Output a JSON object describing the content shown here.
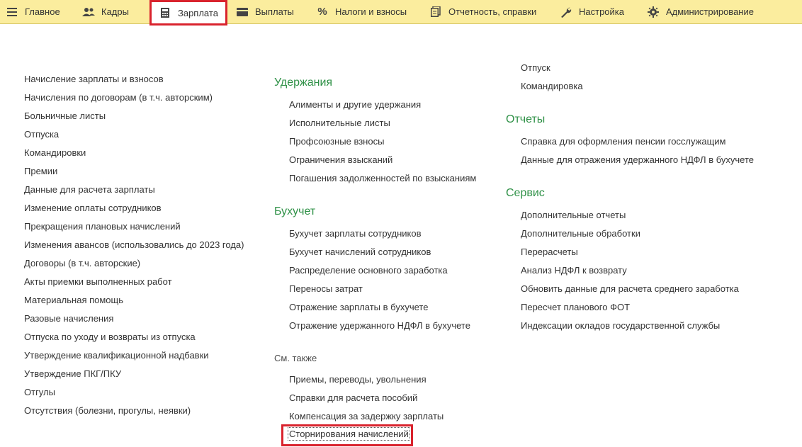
{
  "nav": {
    "tabs": [
      {
        "label": "Главное",
        "icon": "hamburger-menu-icon"
      },
      {
        "label": "Кадры",
        "icon": "people-icon"
      },
      {
        "label": "Зарплата",
        "icon": "calculator-icon",
        "active": true
      },
      {
        "label": "Выплаты",
        "icon": "wallet-icon"
      },
      {
        "label": "Налоги и взносы",
        "icon": "percent-icon"
      },
      {
        "label": "Отчетность, справки",
        "icon": "documents-icon"
      },
      {
        "label": "Настройка",
        "icon": "wrench-icon"
      },
      {
        "label": "Администрирование",
        "icon": "gear-icon"
      }
    ]
  },
  "col1": {
    "items": [
      "Начисление зарплаты и взносов",
      "Начисления по договорам (в т.ч. авторским)",
      "Больничные листы",
      "Отпуска",
      "Командировки",
      "Премии",
      "Данные для расчета зарплаты",
      "Изменение оплаты сотрудников",
      "Прекращения плановых начислений",
      "Изменения авансов (использовались до 2023 года)",
      "Договоры (в т.ч. авторские)",
      "Акты приемки выполненных работ",
      "Материальная помощь",
      "Разовые начисления",
      "Отпуска по уходу и возвраты из отпуска",
      "Утверждение квалификационной надбавки",
      "Утверждение ПКГ/ПКУ",
      "Отгулы",
      "Отсутствия (болезни, прогулы, неявки)"
    ]
  },
  "col2": {
    "uderzhaniya": {
      "title": "Удержания",
      "items": [
        "Алименты и другие удержания",
        "Исполнительные листы",
        "Профсоюзные взносы",
        "Ограничения взысканий",
        "Погашения задолженностей по взысканиям"
      ]
    },
    "buhuchet": {
      "title": "Бухучет",
      "items": [
        "Бухучет зарплаты сотрудников",
        "Бухучет начислений сотрудников",
        "Распределение основного заработка",
        "Переносы затрат",
        "Отражение зарплаты в бухучете",
        "Отражение удержанного НДФЛ в бухучете"
      ]
    },
    "see_also": {
      "title": "См. также",
      "items": [
        "Приемы, переводы, увольнения",
        "Справки для расчета пособий",
        "Компенсация за задержку зарплаты",
        "Сторнирования начислений"
      ]
    }
  },
  "col3": {
    "top_items": [
      "Отпуск",
      "Командировка"
    ],
    "otchety": {
      "title": "Отчеты",
      "items": [
        "Справка для оформления пенсии госслужащим",
        "Данные для отражения удержанного НДФЛ в бухучете"
      ]
    },
    "servis": {
      "title": "Сервис",
      "items": [
        "Дополнительные отчеты",
        "Дополнительные обработки",
        "Перерасчеты",
        "Анализ НДФЛ к возврату",
        "Обновить данные для расчета среднего заработка",
        "Пересчет планового ФОТ",
        "Индексации окладов государственной службы"
      ]
    }
  },
  "colors": {
    "topbar_bg": "#fbed9e",
    "section_green": "#2f9147",
    "highlight_red": "#d9232d"
  }
}
